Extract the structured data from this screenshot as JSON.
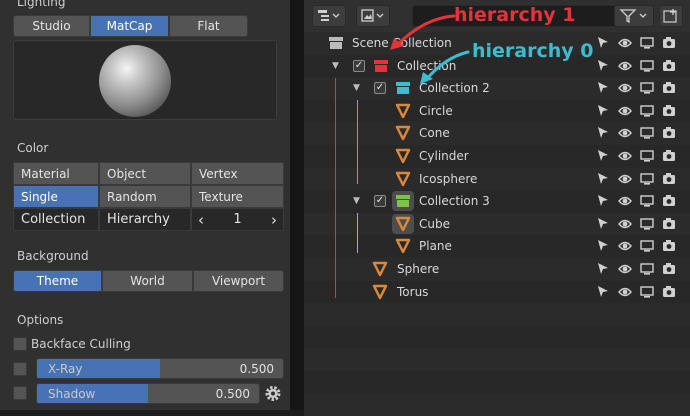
{
  "left": {
    "lighting": {
      "title": "Lighting",
      "options": [
        "Studio",
        "MatCap",
        "Flat"
      ],
      "active": "MatCap"
    },
    "color": {
      "title": "Color",
      "row1": [
        "Material",
        "Object",
        "Vertex"
      ],
      "row2": [
        "Single",
        "Random",
        "Texture"
      ],
      "row3": {
        "collection": "Collection",
        "hierarchy": "Hierarchy",
        "number": "1",
        "prev": "‹",
        "next": "›"
      },
      "active": "Single"
    },
    "background": {
      "title": "Background",
      "options": [
        "Theme",
        "World",
        "Viewport"
      ],
      "active": "Theme"
    },
    "options": {
      "title": "Options",
      "backface": "Backface Culling",
      "xray": {
        "label": "X-Ray",
        "value": "0.500",
        "fraction": 0.5
      },
      "shadow": {
        "label": "Shadow",
        "value": "0.500",
        "fraction": 0.5
      }
    }
  },
  "outliner": {
    "annotations": {
      "h1": "hierarchy 1",
      "h0": "hierarchy 0"
    },
    "rows": [
      {
        "label": "Scene Collection"
      },
      {
        "label": "Collection"
      },
      {
        "label": "Collection 2"
      },
      {
        "label": "Circle"
      },
      {
        "label": "Cone"
      },
      {
        "label": "Cylinder"
      },
      {
        "label": "Icosphere"
      },
      {
        "label": "Collection 3"
      },
      {
        "label": "Cube"
      },
      {
        "label": "Plane"
      },
      {
        "label": "Sphere"
      },
      {
        "label": "Torus"
      }
    ]
  },
  "colors": {
    "accent": "#4772b3",
    "red": "#e5333c",
    "cyan": "#3cbcd0",
    "green": "#7ec24a",
    "orange": "#d9883c"
  }
}
